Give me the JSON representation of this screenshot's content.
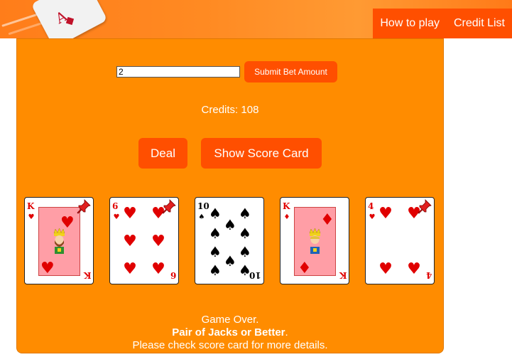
{
  "nav": {
    "how_to_play": "How to play",
    "credit_list": "Credit List"
  },
  "logo": {
    "letter": "A"
  },
  "bet": {
    "value": "2",
    "submit_label": "Submit Bet Amount"
  },
  "credits": {
    "label": "Credits:",
    "value": "108"
  },
  "actions": {
    "deal": "Deal",
    "score_card": "Show Score Card"
  },
  "cards": [
    {
      "rank": "K",
      "suit": "hearts",
      "suit_symbol": "♥",
      "held": true
    },
    {
      "rank": "6",
      "suit": "hearts",
      "suit_symbol": "♥",
      "held": true
    },
    {
      "rank": "10",
      "suit": "spades",
      "suit_symbol": "♠",
      "held": false
    },
    {
      "rank": "K",
      "suit": "diamonds",
      "suit_symbol": "♦",
      "held": false
    },
    {
      "rank": "4",
      "suit": "hearts",
      "suit_symbol": "♥",
      "held": true
    }
  ],
  "status": {
    "line1": "Game Over.",
    "result": "Pair of Jacks or Better",
    "result_suffix": ".",
    "line3": "Please check score card for more details."
  },
  "colors": {
    "panel": "#ff8c00",
    "accent": "#ff4f00",
    "red_suit": "#e00000"
  },
  "icons": {
    "pin": "pin-icon"
  }
}
